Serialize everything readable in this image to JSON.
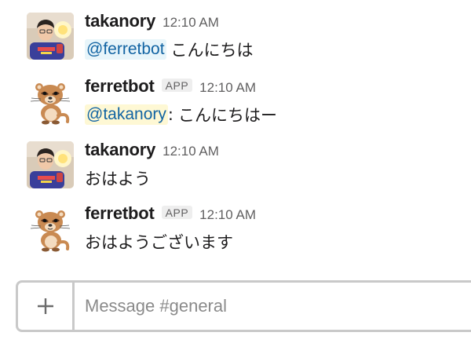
{
  "messages": [
    {
      "sender": "takanory",
      "time": "12:10 AM",
      "mention": "@ferretbot",
      "mention_suffix": "",
      "text": "こんにちは",
      "avatar": "user-photo-takanory"
    },
    {
      "sender": "ferretbot",
      "badge": "APP",
      "time": "12:10 AM",
      "mention": "@takanory",
      "mention_suffix": ":",
      "text": "こんにちはー",
      "avatar": "ferret-icon"
    },
    {
      "sender": "takanory",
      "time": "12:10 AM",
      "text": "おはよう",
      "avatar": "user-photo-takanory"
    },
    {
      "sender": "ferretbot",
      "badge": "APP",
      "time": "12:10 AM",
      "text": "おはようございます",
      "avatar": "ferret-icon"
    }
  ],
  "composer": {
    "plus_icon": "plus-icon",
    "placeholder": "Message #general",
    "value": ""
  },
  "colors": {
    "mention_text": "#1264a3",
    "mention_bg": "#e8f5fa",
    "mention_self_bg": "#fef8d4",
    "muted": "#616061",
    "border": "#c9c9c9"
  }
}
